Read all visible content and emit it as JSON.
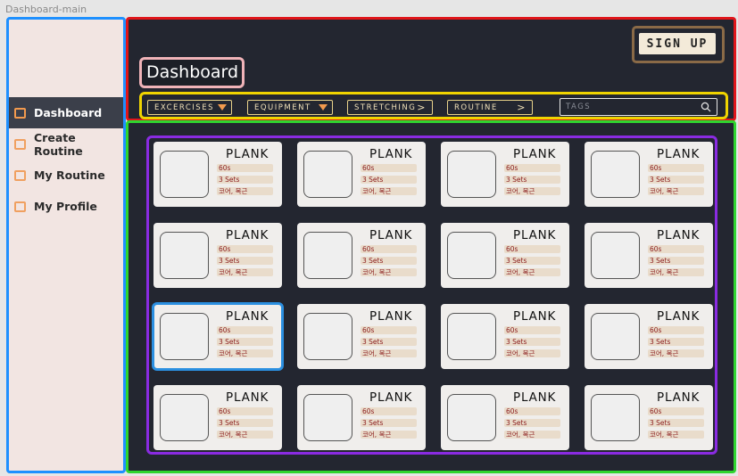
{
  "frame_label": "Dashboard-main",
  "sidebar": {
    "items": [
      {
        "label": "Dashboard",
        "active": true
      },
      {
        "label": "Create Routine",
        "active": false
      },
      {
        "label": "My Routine",
        "active": false
      },
      {
        "label": "My Profile",
        "active": false
      }
    ]
  },
  "header": {
    "title": "Dashboard",
    "signup_label": "SIGN UP",
    "filters": [
      {
        "label": "EXCERCISES",
        "icon": "triangle-down-icon"
      },
      {
        "label": "EQUIPMENT",
        "icon": "triangle-down-icon"
      },
      {
        "label": "STRETCHING",
        "icon": "chevron-right-icon"
      },
      {
        "label": "ROUTINE",
        "icon": "chevron-right-icon"
      }
    ],
    "tags_placeholder": "TAGS"
  },
  "colors": {
    "accent": "#f29a4e",
    "panel": "#232630",
    "sidebar": "#f2e5e2",
    "selected_card": "#2b8fe0"
  },
  "cards": [
    {
      "title": "PLANK",
      "duration": "60s",
      "sets": "3 Sets",
      "target": "코어, 복근"
    },
    {
      "title": "PLANK",
      "duration": "60s",
      "sets": "3 Sets",
      "target": "코어, 복근"
    },
    {
      "title": "PLANK",
      "duration": "60s",
      "sets": "3 Sets",
      "target": "코어, 복근"
    },
    {
      "title": "PLANK",
      "duration": "60s",
      "sets": "3 Sets",
      "target": "코어, 복근"
    },
    {
      "title": "PLANK",
      "duration": "60s",
      "sets": "3 Sets",
      "target": "코어, 복근"
    },
    {
      "title": "PLANK",
      "duration": "60s",
      "sets": "3 Sets",
      "target": "코어, 복근"
    },
    {
      "title": "PLANK",
      "duration": "60s",
      "sets": "3 Sets",
      "target": "코어, 복근"
    },
    {
      "title": "PLANK",
      "duration": "60s",
      "sets": "3 Sets",
      "target": "코어, 복근"
    },
    {
      "title": "PLANK",
      "duration": "60s",
      "sets": "3 Sets",
      "target": "코어, 복근",
      "selected": true
    },
    {
      "title": "PLANK",
      "duration": "60s",
      "sets": "3 Sets",
      "target": "코어, 복근"
    },
    {
      "title": "PLANK",
      "duration": "60s",
      "sets": "3 Sets",
      "target": "코어, 복근"
    },
    {
      "title": "PLANK",
      "duration": "60s",
      "sets": "3 Sets",
      "target": "코어, 복근"
    },
    {
      "title": "PLANK",
      "duration": "60s",
      "sets": "3 Sets",
      "target": "코어, 복근"
    },
    {
      "title": "PLANK",
      "duration": "60s",
      "sets": "3 Sets",
      "target": "코어, 복근"
    },
    {
      "title": "PLANK",
      "duration": "60s",
      "sets": "3 Sets",
      "target": "코어, 복근"
    },
    {
      "title": "PLANK",
      "duration": "60s",
      "sets": "3 Sets",
      "target": "코어, 복근"
    }
  ]
}
